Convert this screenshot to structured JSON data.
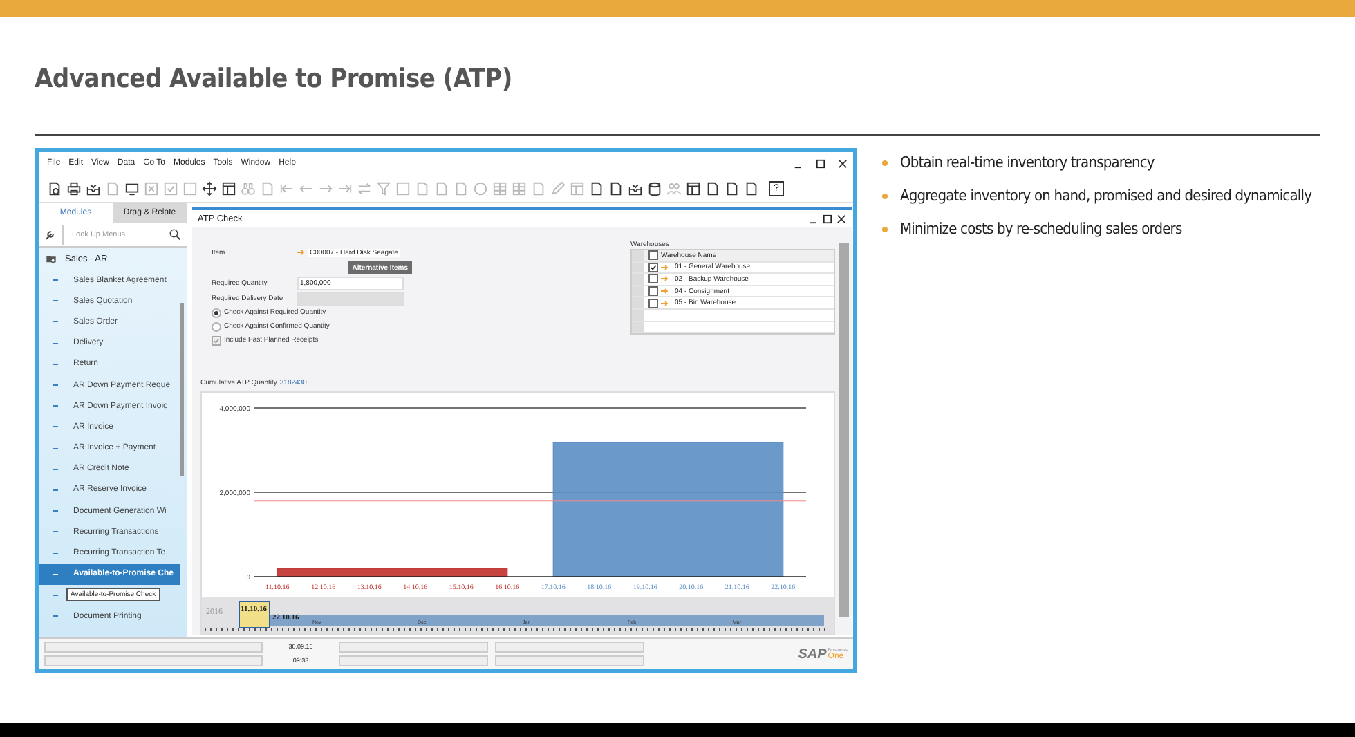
{
  "slide": {
    "title": "Advanced Available to Promise (ATP)",
    "bullets": [
      "Obtain real-time inventory transparency",
      "Aggregate inventory on hand, promised and desired dynamically",
      "Minimize costs by re-scheduling sales orders"
    ]
  },
  "app": {
    "menu": [
      "File",
      "Edit",
      "View",
      "Data",
      "Go To",
      "Modules",
      "Tools",
      "Window",
      "Help"
    ],
    "toolbar": [
      {
        "kind": "document-search",
        "disabled": false
      },
      {
        "kind": "printer",
        "disabled": false
      },
      {
        "kind": "tray",
        "disabled": false
      },
      {
        "kind": "document",
        "disabled": true
      },
      {
        "kind": "monitor",
        "disabled": false
      },
      {
        "kind": "crossed-box",
        "disabled": true
      },
      {
        "kind": "checked-box",
        "disabled": true
      },
      {
        "kind": "blank-box",
        "disabled": true
      },
      {
        "kind": "move",
        "disabled": false
      },
      {
        "kind": "window",
        "disabled": false
      },
      {
        "kind": "binoculars",
        "disabled": true
      },
      {
        "kind": "document",
        "disabled": true
      },
      {
        "kind": "first",
        "disabled": true
      },
      {
        "kind": "previous",
        "disabled": true
      },
      {
        "kind": "next",
        "disabled": true
      },
      {
        "kind": "last",
        "disabled": true
      },
      {
        "kind": "swap",
        "disabled": true
      },
      {
        "kind": "funnel",
        "disabled": true
      },
      {
        "kind": "blank-box",
        "disabled": true
      },
      {
        "kind": "document",
        "disabled": true
      },
      {
        "kind": "document",
        "disabled": true
      },
      {
        "kind": "document",
        "disabled": true
      },
      {
        "kind": "circle",
        "disabled": true
      },
      {
        "kind": "table",
        "disabled": true
      },
      {
        "kind": "table",
        "disabled": true
      },
      {
        "kind": "document",
        "disabled": true
      },
      {
        "kind": "pencil",
        "disabled": true
      },
      {
        "kind": "window",
        "disabled": true
      },
      {
        "kind": "document",
        "disabled": false
      },
      {
        "kind": "document",
        "disabled": false
      },
      {
        "kind": "tray",
        "disabled": false
      },
      {
        "kind": "database",
        "disabled": false
      },
      {
        "kind": "people",
        "disabled": true
      },
      {
        "kind": "window",
        "disabled": false
      },
      {
        "kind": "document",
        "disabled": false
      },
      {
        "kind": "document",
        "disabled": false
      },
      {
        "kind": "document",
        "disabled": false
      },
      {
        "kind": "help",
        "glyph": "?",
        "disabled": false
      }
    ],
    "sidebar": {
      "tabs": [
        {
          "label": "Modules",
          "selected": true
        },
        {
          "label": "Drag & Relate",
          "selected": false
        }
      ],
      "search": {
        "placeholder": "Look Up Menus"
      },
      "group": "Sales - AR",
      "items": [
        {
          "label": "Sales Blanket Agreement",
          "selected": false
        },
        {
          "label": "Sales Quotation",
          "selected": false
        },
        {
          "label": "Sales Order",
          "selected": false
        },
        {
          "label": "Delivery",
          "selected": false
        },
        {
          "label": "Return",
          "selected": false
        },
        {
          "label": "AR Down Payment Reque",
          "selected": false
        },
        {
          "label": "AR Down Payment Invoic",
          "selected": false
        },
        {
          "label": "AR Invoice",
          "selected": false
        },
        {
          "label": "AR Invoice + Payment",
          "selected": false
        },
        {
          "label": "AR Credit Note",
          "selected": false
        },
        {
          "label": "AR Reserve Invoice",
          "selected": false
        },
        {
          "label": "Document Generation Wi",
          "selected": false
        },
        {
          "label": "Recurring Transactions",
          "selected": false
        },
        {
          "label": "Recurring Transaction Te",
          "selected": false
        },
        {
          "label": "Available-to-Promise Che",
          "selected": true
        },
        {
          "selected": false,
          "tooltip": "Available-to-Promise Check"
        },
        {
          "label": "Document Printing",
          "selected": false
        }
      ]
    },
    "atp": {
      "title": "ATP Check",
      "item_label": "Item",
      "item_value": "C00007 - Hard Disk Seagate",
      "alternative_button": "Alternative Items",
      "fields": [
        {
          "label": "Required Quantity",
          "value": "1,800,000",
          "disabled": false
        },
        {
          "label": "Required Delivery Date",
          "disabled": true
        }
      ],
      "radios": [
        {
          "label": "Check Against Required Quantity",
          "selected": true
        },
        {
          "label": "Check Against Confirmed Quantity",
          "selected": false
        }
      ],
      "checkbox": {
        "label": "Include Past Planned Receipts",
        "checked": true,
        "disabled": true
      },
      "warehouses": {
        "title": "Warehouses",
        "header": "Warehouse Name",
        "header_checked": false,
        "rows": [
          {
            "name": "01 - General Warehouse",
            "checked": true
          },
          {
            "name": "02 - Backup Warehouse",
            "checked": false
          },
          {
            "name": "04 - Consignment",
            "checked": false
          },
          {
            "name": "05 - Bin Warehouse",
            "checked": false
          }
        ]
      },
      "cumulative_label": "Cumulative ATP Quantity",
      "cumulative_value": "3182430",
      "chart_data": {
        "type": "area",
        "categories": [
          "11.10.16",
          "12.10.16",
          "13.10.16",
          "14.10.16",
          "15.10.16",
          "16.10.16",
          "17.10.16",
          "18.10.16",
          "19.10.16",
          "20.10.16",
          "21.10.16",
          "22.10.16"
        ],
        "series": [
          {
            "color": "#c0302c",
            "values": [
              200000,
              200000,
              200000,
              200000,
              200000,
              200000,
              null,
              null,
              null,
              null,
              null,
              null
            ]
          },
          {
            "color": "#5b8ec4",
            "values": [
              null,
              null,
              null,
              null,
              null,
              null,
              3180000,
              3180000,
              3180000,
              3180000,
              3180000,
              3180000
            ]
          }
        ],
        "ylim": [
          0,
          4000000
        ],
        "yticks": [
          {
            "value": 0,
            "label": "0"
          },
          {
            "value": 2000000,
            "label": "2,000,000"
          },
          {
            "value": 4000000,
            "label": "4,000,000"
          }
        ],
        "ref_lines": [
          {
            "axis": "y",
            "value": 1800000,
            "color": "#f08a8a"
          }
        ]
      },
      "timeline": {
        "year": "2016",
        "start": "11.10.16",
        "end": "22.10.16",
        "months": [
          "Nov",
          "Dec",
          "Jan",
          "Feb",
          "Mar"
        ]
      }
    },
    "status": {
      "date": "30.09.16",
      "time": "09:33"
    },
    "logo": {
      "brand": "SAP",
      "line_1": "Business",
      "line_2": "One"
    }
  }
}
